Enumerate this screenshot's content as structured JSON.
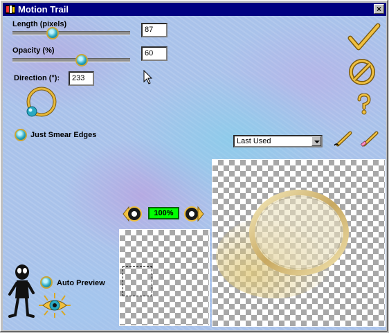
{
  "window": {
    "title": "Motion Trail",
    "close_glyph": "×"
  },
  "length": {
    "label": "Length (pixels)",
    "value": "87",
    "level": 0.32
  },
  "opacity": {
    "label": "Opacity (%)",
    "value": "60",
    "level": 0.6
  },
  "direction": {
    "label": "Direction (°):",
    "value": "233"
  },
  "smear": {
    "label": "Just Smear Edges"
  },
  "preset": {
    "selected": "Last Used"
  },
  "zoom": {
    "value": "100%"
  },
  "auto_preview": {
    "label": "Auto Preview"
  },
  "icons": [
    "checkmark-icon",
    "cancel-icon",
    "help-icon",
    "save-preset-icon",
    "delete-preset-icon",
    "zoom-in-icon",
    "zoom-out-icon",
    "mascot-icon",
    "eye-icon",
    "mouse-pointer-icon"
  ],
  "colors": {
    "titlebar": "#000080",
    "gold": "#d9a825",
    "teal": "#2aa9c2",
    "zoom_badge": "#00ff00"
  }
}
